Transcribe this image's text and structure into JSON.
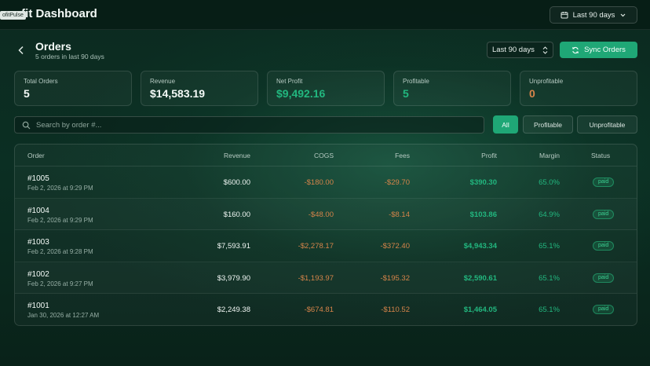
{
  "app": {
    "brand": "ofitPulse",
    "title": "ofit Dashboard",
    "range_label": "Last 90 days"
  },
  "page": {
    "title": "Orders",
    "subtitle": "5 orders in last 90 days",
    "range_select": "Last 90 days",
    "sync_label": "Sync Orders"
  },
  "stats": [
    {
      "label": "Total Orders",
      "value": "5"
    },
    {
      "label": "Revenue",
      "value": "$14,583.19"
    },
    {
      "label": "Net Profit",
      "value": "$9,492.16"
    },
    {
      "label": "Profitable",
      "value": "5"
    },
    {
      "label": "Unprofitable",
      "value": "0"
    }
  ],
  "search": {
    "placeholder": "Search by order #..."
  },
  "filters": {
    "all": "All",
    "profitable": "Profitable",
    "unprofitable": "Unprofitable"
  },
  "table": {
    "headers": {
      "order": "Order",
      "revenue": "Revenue",
      "cogs": "COGS",
      "fees": "Fees",
      "profit": "Profit",
      "margin": "Margin",
      "status": "Status"
    },
    "rows": [
      {
        "id": "#1005",
        "date": "Feb 2, 2026 at 9:29 PM",
        "revenue": "$600.00",
        "cogs": "-$180.00",
        "fees": "-$29.70",
        "profit": "$390.30",
        "margin": "65.0%",
        "status": "paid"
      },
      {
        "id": "#1004",
        "date": "Feb 2, 2026 at 9:29 PM",
        "revenue": "$160.00",
        "cogs": "-$48.00",
        "fees": "-$8.14",
        "profit": "$103.86",
        "margin": "64.9%",
        "status": "paid"
      },
      {
        "id": "#1003",
        "date": "Feb 2, 2026 at 9:28 PM",
        "revenue": "$7,593.91",
        "cogs": "-$2,278.17",
        "fees": "-$372.40",
        "profit": "$4,943.34",
        "margin": "65.1%",
        "status": "paid"
      },
      {
        "id": "#1002",
        "date": "Feb 2, 2026 at 9:27 PM",
        "revenue": "$3,979.90",
        "cogs": "-$1,193.97",
        "fees": "-$195.32",
        "profit": "$2,590.61",
        "margin": "65.1%",
        "status": "paid"
      },
      {
        "id": "#1001",
        "date": "Jan 30, 2026 at 12:27 AM",
        "revenue": "$2,249.38",
        "cogs": "-$674.81",
        "fees": "-$110.52",
        "profit": "$1,464.05",
        "margin": "65.1%",
        "status": "paid"
      }
    ]
  },
  "colors": {
    "accent": "#1fa776",
    "positive": "#22b77f",
    "negative": "#d6844a"
  }
}
